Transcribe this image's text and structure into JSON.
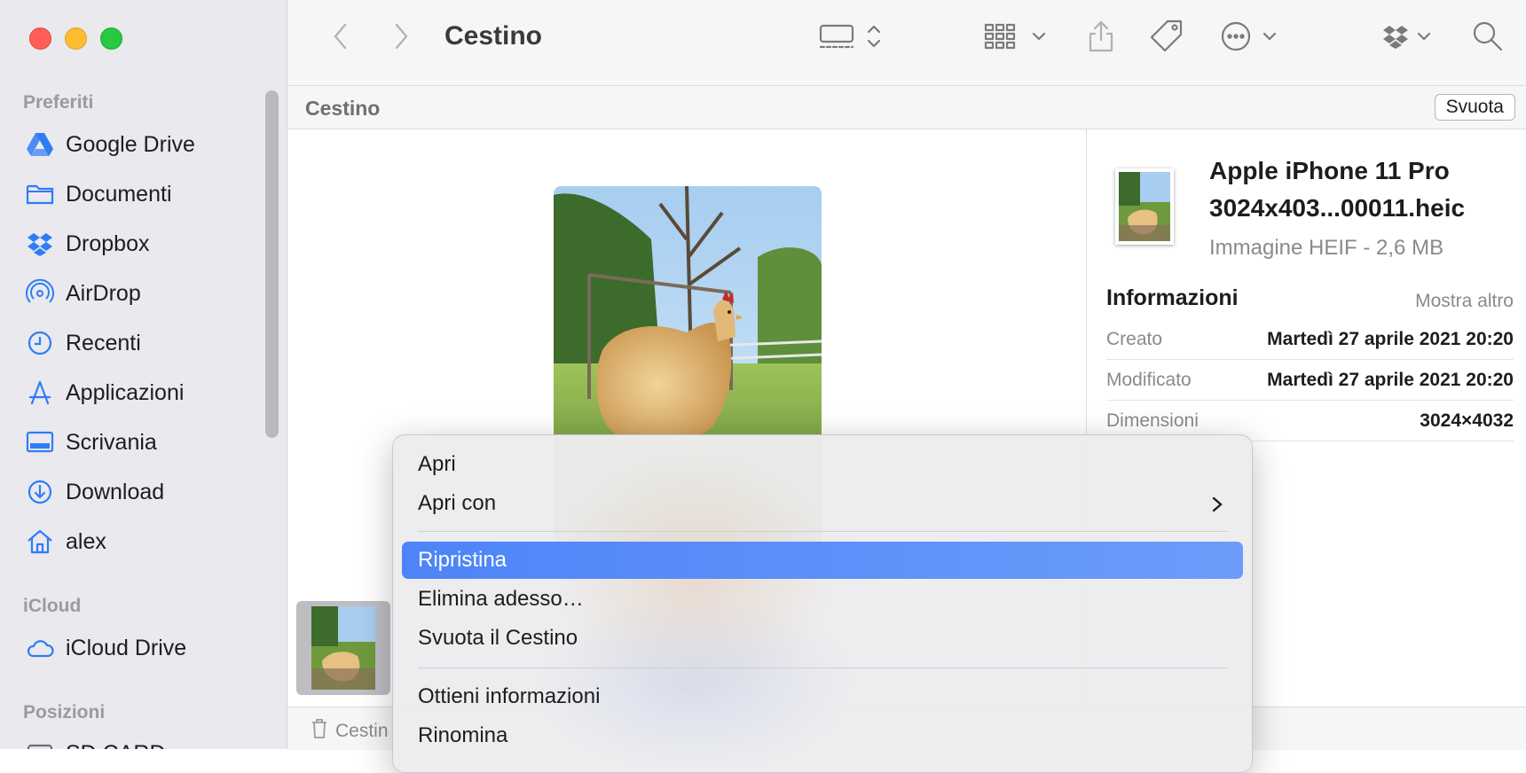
{
  "window": {
    "title": "Cestino"
  },
  "sidebar": {
    "favorites_title": "Preferiti",
    "favorites": [
      {
        "label": "Google Drive",
        "icon": "google-drive-icon"
      },
      {
        "label": "Documenti",
        "icon": "folder-icon"
      },
      {
        "label": "Dropbox",
        "icon": "dropbox-icon"
      },
      {
        "label": "AirDrop",
        "icon": "airdrop-icon"
      },
      {
        "label": "Recenti",
        "icon": "clock-icon"
      },
      {
        "label": "Applicazioni",
        "icon": "applications-icon"
      },
      {
        "label": "Scrivania",
        "icon": "desktop-icon"
      },
      {
        "label": "Download",
        "icon": "download-icon"
      },
      {
        "label": "alex",
        "icon": "home-icon"
      }
    ],
    "icloud_title": "iCloud",
    "icloud": [
      {
        "label": "iCloud Drive",
        "icon": "cloud-icon"
      }
    ],
    "locations_title": "Posizioni",
    "locations": [
      {
        "label": "SD CARD",
        "icon": "drive-icon"
      }
    ]
  },
  "pathbar": {
    "label": "Cestino",
    "empty_button": "Svuota"
  },
  "info": {
    "name_line1": "Apple iPhone 11 Pro",
    "name_line2": "3024x403...00011.heic",
    "kind": "Immagine HEIF - 2,6 MB",
    "section_title": "Informazioni",
    "show_more": "Mostra altro",
    "rows": [
      {
        "key": "Creato",
        "value": "Martedì 27 aprile 2021 20:20"
      },
      {
        "key": "Modificato",
        "value": "Martedì 27 aprile 2021 20:20"
      },
      {
        "key": "Dimensioni",
        "value": "3024×4032"
      }
    ]
  },
  "statusbar": {
    "path": "Cestin"
  },
  "context_menu": {
    "items": [
      {
        "label": "Apri"
      },
      {
        "label": "Apri con"
      },
      {
        "label": "Ripristina"
      },
      {
        "label": "Elimina adesso…"
      },
      {
        "label": "Svuota il Cestino"
      },
      {
        "label": "Ottieni informazioni"
      },
      {
        "label": "Rinomina"
      }
    ]
  },
  "colors": {
    "accent": "#4d84f7",
    "close": "#ff5f57",
    "minimize": "#febc2e",
    "zoom": "#28c840",
    "sidebar_icon": "#2f7cf6"
  }
}
